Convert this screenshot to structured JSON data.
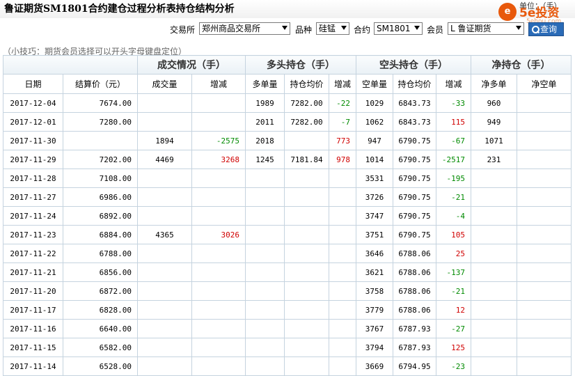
{
  "header": {
    "title": "鲁证期货SM1801合约建仓过程分析表持仓结构分析",
    "unit": "单位：（手）",
    "logo": {
      "circle": "e",
      "text": "5e投资",
      "sub": "5ehou.com"
    }
  },
  "filters": {
    "exchange_label": "交易所",
    "exchange_value": "郑州商品交易所",
    "product_label": "品种",
    "product_value": "硅锰",
    "contract_label": "合约",
    "contract_value": "SM1801",
    "member_label": "会员",
    "member_value": "L 鲁证期货",
    "query_label": "查询"
  },
  "tip": "（小技巧：期货会员选择可以开头字母键盘定位）",
  "table": {
    "groups": [
      "成交情况（手）",
      "多头持仓（手）",
      "空头持仓（手）",
      "净持仓（手）"
    ],
    "columns": [
      "日期",
      "结算价（元）",
      "成交量",
      "增减",
      "多单量",
      "持仓均价",
      "增减",
      "空单量",
      "持仓均价",
      "增减",
      "净多单",
      "净空单"
    ],
    "rows": [
      [
        "2017-12-04",
        "7674.00",
        "",
        "",
        "1989",
        "7282.00",
        "-22",
        "1029",
        "6843.73",
        "-33",
        "960",
        ""
      ],
      [
        "2017-12-01",
        "7280.00",
        "",
        "",
        "2011",
        "7282.00",
        "-7",
        "1062",
        "6843.73",
        "115",
        "949",
        ""
      ],
      [
        "2017-11-30",
        "",
        "1894",
        "-2575",
        "2018",
        "",
        "773",
        "947",
        "6790.75",
        "-67",
        "1071",
        ""
      ],
      [
        "2017-11-29",
        "7202.00",
        "4469",
        "3268",
        "1245",
        "7181.84",
        "978",
        "1014",
        "6790.75",
        "-2517",
        "231",
        ""
      ],
      [
        "2017-11-28",
        "7108.00",
        "",
        "",
        "",
        "",
        "",
        "3531",
        "6790.75",
        "-195",
        "",
        ""
      ],
      [
        "2017-11-27",
        "6986.00",
        "",
        "",
        "",
        "",
        "",
        "3726",
        "6790.75",
        "-21",
        "",
        ""
      ],
      [
        "2017-11-24",
        "6892.00",
        "",
        "",
        "",
        "",
        "",
        "3747",
        "6790.75",
        "-4",
        "",
        ""
      ],
      [
        "2017-11-23",
        "6884.00",
        "4365",
        "3026",
        "",
        "",
        "",
        "3751",
        "6790.75",
        "105",
        "",
        ""
      ],
      [
        "2017-11-22",
        "6788.00",
        "",
        "",
        "",
        "",
        "",
        "3646",
        "6788.06",
        "25",
        "",
        ""
      ],
      [
        "2017-11-21",
        "6856.00",
        "",
        "",
        "",
        "",
        "",
        "3621",
        "6788.06",
        "-137",
        "",
        ""
      ],
      [
        "2017-11-20",
        "6872.00",
        "",
        "",
        "",
        "",
        "",
        "3758",
        "6788.06",
        "-21",
        "",
        ""
      ],
      [
        "2017-11-17",
        "6828.00",
        "",
        "",
        "",
        "",
        "",
        "3779",
        "6788.06",
        "12",
        "",
        ""
      ],
      [
        "2017-11-16",
        "6640.00",
        "",
        "",
        "",
        "",
        "",
        "3767",
        "6787.93",
        "-27",
        "",
        ""
      ],
      [
        "2017-11-15",
        "6582.00",
        "",
        "",
        "",
        "",
        "",
        "3794",
        "6787.93",
        "125",
        "",
        ""
      ],
      [
        "2017-11-14",
        "6528.00",
        "",
        "",
        "",
        "",
        "",
        "3669",
        "6794.95",
        "-23",
        "",
        ""
      ]
    ]
  },
  "colors": {
    "positive": "#d00000",
    "negative": "#008a00",
    "accent": "#2a6bb7",
    "brand": "#e8590c"
  }
}
